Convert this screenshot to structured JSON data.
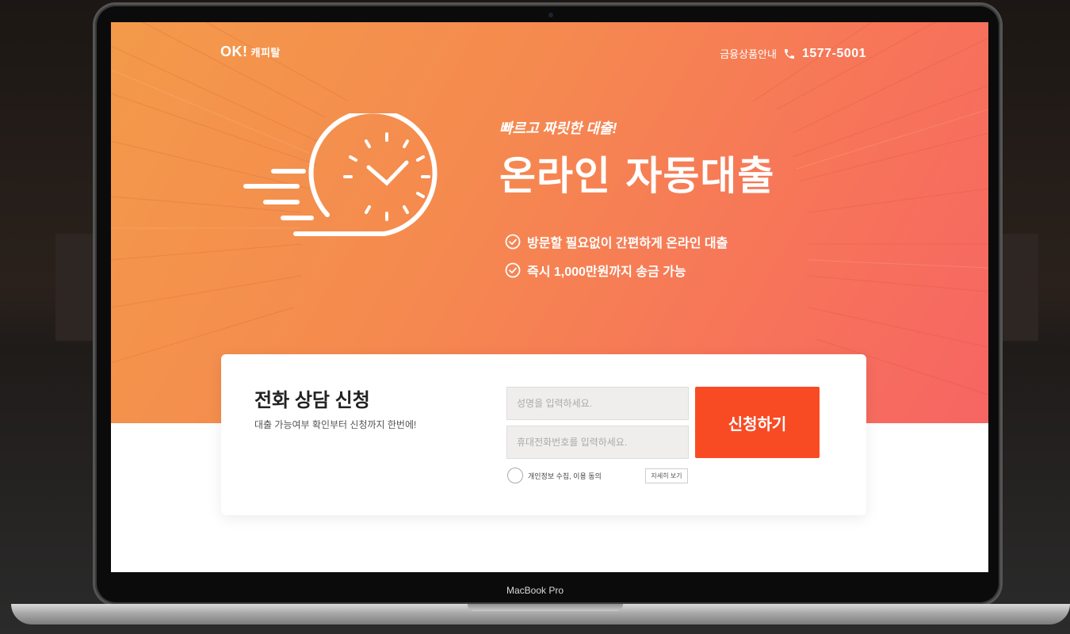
{
  "device_label": "MacBook Pro",
  "header": {
    "logo_mark": "OK!",
    "logo_text": "캐피탈",
    "nav_link": "금융상품안내",
    "phone": "1577-5001"
  },
  "hero": {
    "kicker": "빠르고 짜릿한 대출!",
    "title": "온라인 자동대출",
    "benefits": [
      "방문할 필요없이 간편하게 온라인 대출",
      "즉시 1,000만원까지 송금 가능"
    ]
  },
  "form": {
    "title": "전화 상담 신청",
    "subtitle": "대출 가능여부 확인부터 신청까지 한번에!",
    "name_placeholder": "성명을 입력하세요.",
    "phone_placeholder": "휴대전화번호를 입력하세요.",
    "submit_label": "신청하기",
    "consent_label": "개인정보 수집, 이용 동의",
    "detail_label": "자세히 보기"
  },
  "colors": {
    "accent": "#f84b24",
    "hero_start": "#f39a4a",
    "hero_end": "#f66563"
  }
}
